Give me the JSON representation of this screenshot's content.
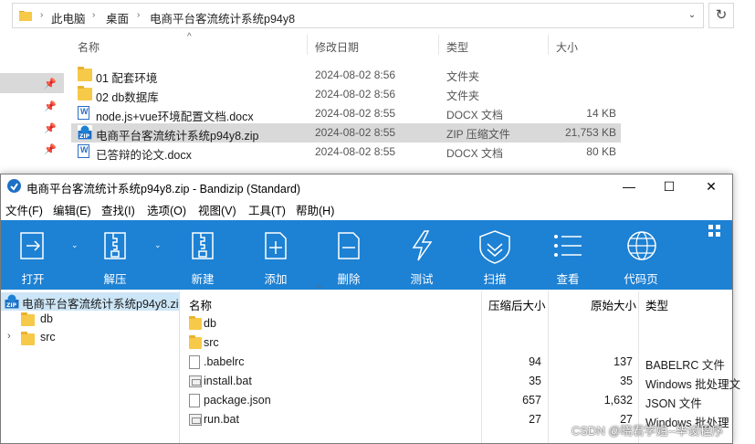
{
  "explorer": {
    "breadcrumb": [
      "此电脑",
      "桌面",
      "电商平台客流统计系统p94y8"
    ],
    "headers": {
      "name": "名称",
      "date": "修改日期",
      "type": "类型",
      "size": "大小"
    },
    "files": [
      {
        "name": "01  配套环境",
        "date": "2024-08-02 8:56",
        "type": "文件夹",
        "size": "",
        "icon": "folder-icon"
      },
      {
        "name": "02 db数据库",
        "date": "2024-08-02 8:56",
        "type": "文件夹",
        "size": "",
        "icon": "folder-icon"
      },
      {
        "name": "node.js+vue环境配置文档.docx",
        "date": "2024-08-02 8:55",
        "type": "DOCX 文档",
        "size": "14 KB",
        "icon": "docx-icon"
      },
      {
        "name": "电商平台客流统计系统p94y8.zip",
        "date": "2024-08-02 8:55",
        "type": "ZIP 压缩文件",
        "size": "21,753 KB",
        "icon": "zip-icon"
      },
      {
        "name": "已答辩的论文.docx",
        "date": "2024-08-02 8:55",
        "type": "DOCX 文档",
        "size": "80 KB",
        "icon": "docx-icon"
      }
    ]
  },
  "bandizip": {
    "title": "电商平台客流统计系统p94y8.zip - Bandizip (Standard)",
    "menu": [
      "文件(F)",
      "编辑(E)",
      "查找(I)",
      "选项(O)",
      "视图(V)",
      "工具(T)",
      "帮助(H)"
    ],
    "toolbar": [
      {
        "label": "打开",
        "icon": "open-icon"
      },
      {
        "label": "解压",
        "icon": "extract-icon"
      },
      {
        "label": "新建",
        "icon": "new-archive-icon"
      },
      {
        "label": "添加",
        "icon": "add-icon"
      },
      {
        "label": "删除",
        "icon": "delete-icon"
      },
      {
        "label": "测试",
        "icon": "test-icon"
      },
      {
        "label": "扫描",
        "icon": "scan-icon"
      },
      {
        "label": "查看",
        "icon": "view-icon"
      },
      {
        "label": "代码页",
        "icon": "codepage-icon"
      }
    ],
    "tree": {
      "root": "电商平台客流统计系统p94y8.zip",
      "children": [
        "db",
        "src"
      ]
    },
    "list_headers": {
      "name": "名称",
      "packed": "压缩后大小",
      "original": "原始大小",
      "type": "类型"
    },
    "entries": [
      {
        "name": "db",
        "packed": "",
        "original": "",
        "type": "",
        "icon": "folder-icon"
      },
      {
        "name": "src",
        "packed": "",
        "original": "",
        "type": "",
        "icon": "folder-icon"
      },
      {
        "name": ".babelrc",
        "packed": "94",
        "original": "137",
        "type": "BABELRC 文件",
        "icon": "file-icon"
      },
      {
        "name": "install.bat",
        "packed": "35",
        "original": "35",
        "type": "Windows 批处理文",
        "icon": "bat-icon"
      },
      {
        "name": "package.json",
        "packed": "657",
        "original": "1,632",
        "type": "JSON 文件",
        "icon": "file-icon"
      },
      {
        "name": "run.bat",
        "packed": "27",
        "original": "27",
        "type": "Windows 批处理",
        "icon": "bat-icon"
      }
    ]
  },
  "watermark": "CSDN @晓君学姐--毕设程序"
}
